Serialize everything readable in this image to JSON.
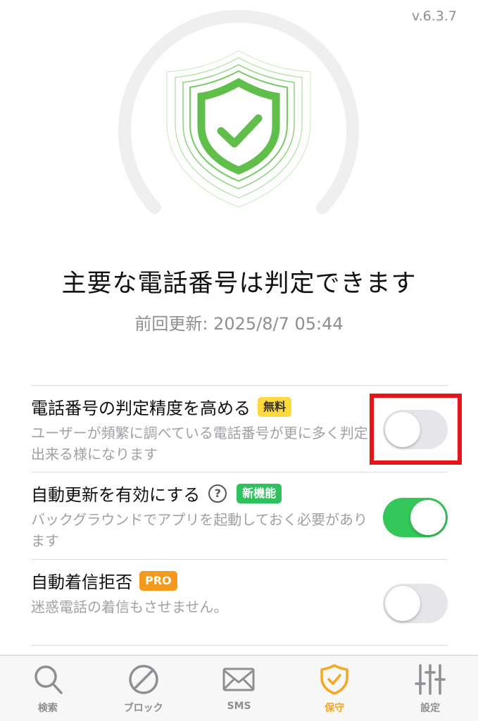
{
  "version": "v.6.3.7",
  "status": {
    "headline": "主要な電話番号は判定できます",
    "last_updated": "前回更新: 2025/8/7 05:44"
  },
  "settings": [
    {
      "title": "電話番号の判定精度を高める",
      "badge": "無料",
      "description": "ユーザーが頻繁に調べている電話番号が更に多く判定出来る様になります",
      "enabled": false
    },
    {
      "title": "自動更新を有効にする",
      "help": "?",
      "badge": "新機能",
      "description": "バックグラウンドでアプリを起動しておく必要があります",
      "enabled": true
    },
    {
      "title": "自動着信拒否",
      "badge": "PRO",
      "description": "迷惑電話の着信もさせません。",
      "enabled": false
    }
  ],
  "tabs": [
    {
      "label": "検索",
      "icon": "search-icon",
      "active": false
    },
    {
      "label": "ブロック",
      "icon": "block-icon",
      "active": false
    },
    {
      "label": "SMS",
      "icon": "mail-icon",
      "active": false
    },
    {
      "label": "保守",
      "icon": "shield-check-icon",
      "active": true
    },
    {
      "label": "設定",
      "icon": "sliders-icon",
      "active": false
    }
  ],
  "colors": {
    "accent": "#f5a623",
    "toggle_on": "#34c759",
    "shield_green": "#5fbf4a",
    "highlight_red": "#e8141a"
  }
}
